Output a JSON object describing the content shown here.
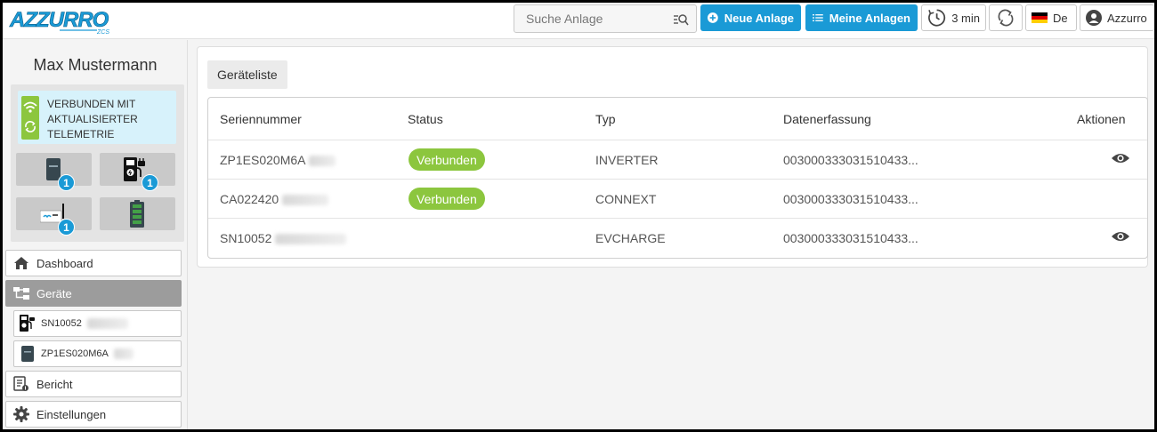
{
  "header": {
    "brand": "AZZURRO ZCS",
    "search_placeholder": "Suche Anlage",
    "new_plant_label": "Neue Anlage",
    "my_plants_label": "Meine Anlagen",
    "refresh_interval": "3 min",
    "language": "De",
    "account_label": "Azzurro",
    "accent_color": "#1a9ad6"
  },
  "sidebar": {
    "user_name": "Max Mustermann",
    "connection_status": "VERBUNDEN MIT AKTUALISIERTER TELEMETRIE",
    "device_tiles": [
      {
        "icon": "inverter-icon",
        "count": "1"
      },
      {
        "icon": "ev-charger-icon",
        "count": "1"
      },
      {
        "icon": "connext-icon",
        "count": "1"
      },
      {
        "icon": "battery-icon",
        "count": null
      }
    ],
    "nav": {
      "dashboard": "Dashboard",
      "devices": "Geräte",
      "device_1": "SN10052",
      "device_2": "ZP1ES020M6A",
      "report": "Bericht",
      "settings": "Einstellungen"
    }
  },
  "main": {
    "card_title": "Geräteliste",
    "columns": [
      "Seriennummer",
      "Status",
      "Typ",
      "Datenerfassung",
      "Aktionen"
    ],
    "rows": [
      {
        "serial": "ZP1ES020M6A",
        "status": "Verbunden",
        "type": "INVERTER",
        "datalogger": "003000333031510433...",
        "action": "eye-icon"
      },
      {
        "serial": "CA022420",
        "status": "Verbunden",
        "type": "CONNEXT",
        "datalogger": "003000333031510433...",
        "action": null
      },
      {
        "serial": "SN10052",
        "status": "",
        "type": "EVCHARGE",
        "datalogger": "003000333031510433...",
        "action": "eye-icon"
      }
    ],
    "status_color": "#8cc63e"
  }
}
